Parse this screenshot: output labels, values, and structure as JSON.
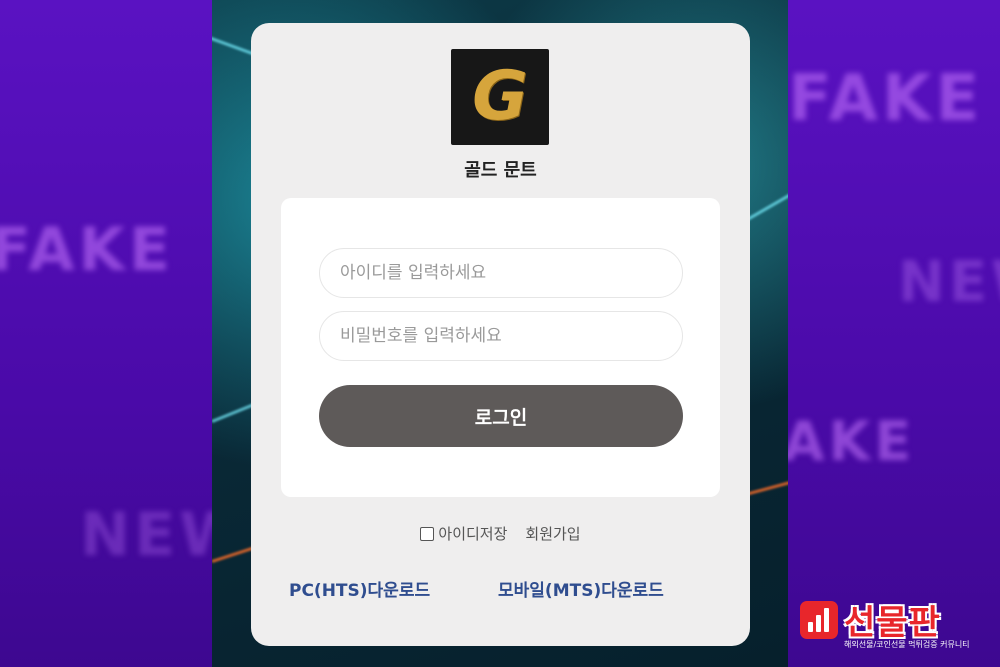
{
  "brand": {
    "logo_letter": "G",
    "name": "골드 문트"
  },
  "login_form": {
    "id_placeholder": "아이디를 입력하세요",
    "password_placeholder": "비밀번호를 입력하세요",
    "login_label": "로그인"
  },
  "options": {
    "remember_id_label": "아이디저장",
    "signup_label": "회원가입"
  },
  "downloads": {
    "pc_label": "PC(HTS)다운로드",
    "mobile_label": "모바일(MTS)다운로드"
  },
  "watermark": {
    "title": "선물판",
    "subtitle": "해외선물/코인선물 먹튀검증 커뮤니티",
    "icon": "bar-chart-icon"
  },
  "background_words": {
    "left_top": "FAKE",
    "left_bottom": "NEW",
    "right_top": "FAKE",
    "right_middle": "NEW",
    "right_lower": "FAKE"
  },
  "colors": {
    "side_purple": "#4a0aa8",
    "card_bg": "#efeeee",
    "login_button": "#5e5a59",
    "download_link": "#2f4d8f",
    "logo_gold": "#d6a53c",
    "watermark_red": "#e8262b"
  }
}
